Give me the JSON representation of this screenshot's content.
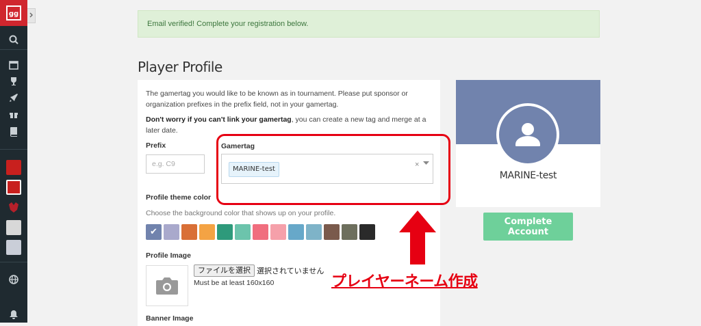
{
  "sidebar": {
    "logo_text": "gg",
    "nav_icons": [
      "search-icon",
      "calendar-icon",
      "trophy-icon",
      "rocket-icon",
      "gift-icon",
      "book-icon"
    ],
    "bottom_icons": [
      "globe-icon",
      "bell-icon"
    ]
  },
  "alert": {
    "message": "Email verified! Complete your registration below."
  },
  "page_title": "Player Profile",
  "form": {
    "intro": "The gamertag you would like to be known as in tournament. Please put sponsor or organization prefixes in the prefix field, not in your gamertag.",
    "note_bold": "Don't worry if you can't link your gamertag",
    "note_rest": ", you can create a new tag and merge at a later date.",
    "prefix_label": "Prefix",
    "prefix_placeholder": "e.g. C9",
    "gamertag_label": "Gamertag",
    "gamertag_value": "MARINE-test",
    "clear_symbol": "×",
    "theme_label": "Profile theme color",
    "theme_hint": "Choose the background color that shows up on your profile.",
    "swatches": [
      "#7183ad",
      "#a9a9cc",
      "#d96f36",
      "#f4a344",
      "#2e9a7b",
      "#6cc4ac",
      "#f06e7e",
      "#f5a0aa",
      "#67a8c9",
      "#7eb3c8",
      "#7a5a4c",
      "#6d6f5d",
      "#2a2a2a"
    ],
    "selected_swatch": 0,
    "profile_image_label": "Profile Image",
    "file_button": "ファイルを選択",
    "file_status": "選択されていません",
    "min_size": "Must be at least 160x160",
    "banner_label": "Banner Image"
  },
  "preview": {
    "name": "MARINE-test",
    "banner_color": "#7183ad"
  },
  "complete_button": "Complete Account",
  "annotation": "プレイヤーネーム作成"
}
